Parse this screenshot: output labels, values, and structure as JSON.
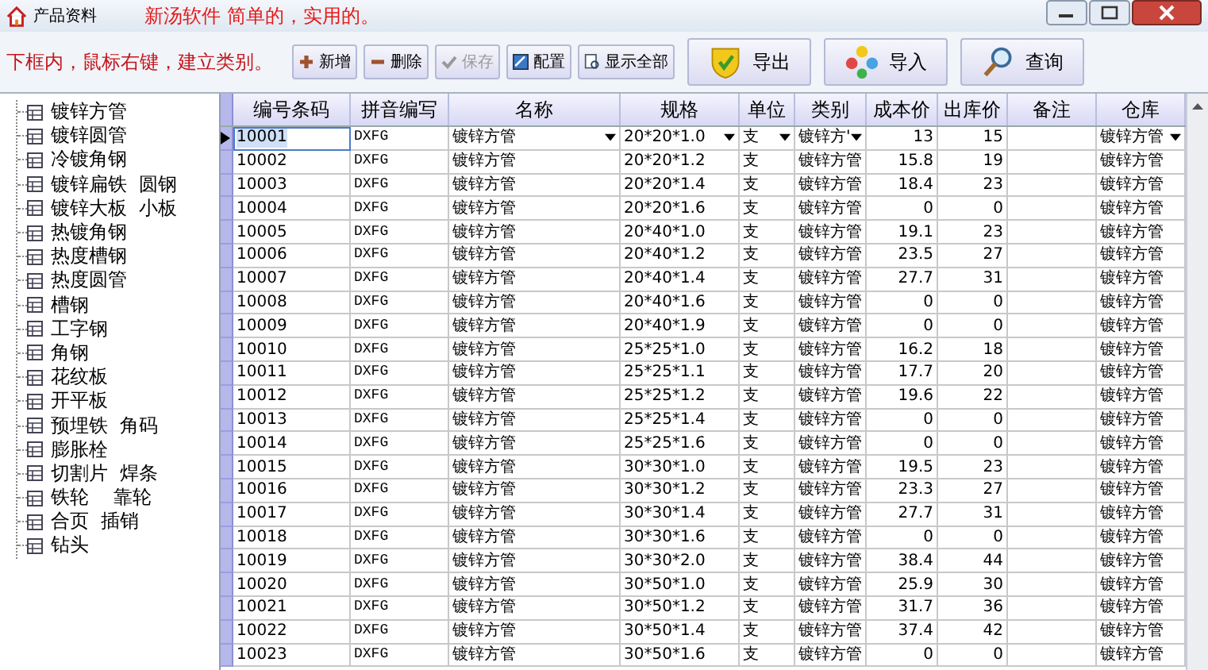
{
  "window": {
    "title": "产品资料",
    "slogan": "新汤软件 简单的，实用的。"
  },
  "toolbar": {
    "hint": "下框内，鼠标右键，建立类别。",
    "buttons": [
      {
        "label": "新增",
        "kind": "small",
        "disabled": false
      },
      {
        "label": "删除",
        "kind": "small",
        "disabled": false
      },
      {
        "label": "保存",
        "kind": "small",
        "disabled": true
      },
      {
        "label": "配置",
        "kind": "small",
        "disabled": false
      },
      {
        "label": "显示全部",
        "kind": "small",
        "disabled": false
      },
      {
        "label": "导出",
        "kind": "large",
        "disabled": false
      },
      {
        "label": "导入",
        "kind": "large",
        "disabled": false
      },
      {
        "label": "查询",
        "kind": "large",
        "disabled": false
      }
    ]
  },
  "sidebar": {
    "items": [
      "镀锌方管",
      "镀锌圆管",
      "冷镀角钢",
      "镀锌扁铁  圆钢",
      "镀锌大板  小板",
      "热镀角钢",
      "热度槽钢",
      "热度圆管",
      "槽钢",
      "工字钢",
      "角钢",
      "花纹板",
      "开平板",
      "预埋铁  角码",
      "膨胀栓",
      "切割片  焊条",
      "铁轮    靠轮",
      "合页  插销",
      "钻头"
    ]
  },
  "table": {
    "columns": [
      "编号条码",
      "拼音编写",
      "名称",
      "规格",
      "单位",
      "类别",
      "成本价",
      "出库价",
      "备注",
      "仓库"
    ],
    "rows": [
      {
        "selected": true,
        "code": "10001",
        "pinyin": "DXFG",
        "name": "镀锌方管",
        "spec": "20*20*1.0",
        "unit": "支",
        "category": "镀锌方'",
        "cost": "13",
        "price": "15",
        "warehouse": "镀锌方管"
      },
      {
        "selected": false,
        "code": "10002",
        "pinyin": "DXFG",
        "name": "镀锌方管",
        "spec": "20*20*1.2",
        "unit": "支",
        "category": "镀锌方管",
        "cost": "15.8",
        "price": "19",
        "warehouse": "镀锌方管"
      },
      {
        "selected": false,
        "code": "10003",
        "pinyin": "DXFG",
        "name": "镀锌方管",
        "spec": "20*20*1.4",
        "unit": "支",
        "category": "镀锌方管",
        "cost": "18.4",
        "price": "23",
        "warehouse": "镀锌方管"
      },
      {
        "selected": false,
        "code": "10004",
        "pinyin": "DXFG",
        "name": "镀锌方管",
        "spec": "20*20*1.6",
        "unit": "支",
        "category": "镀锌方管",
        "cost": "0",
        "price": "0",
        "warehouse": "镀锌方管"
      },
      {
        "selected": false,
        "code": "10005",
        "pinyin": "DXFG",
        "name": "镀锌方管",
        "spec": "20*40*1.0",
        "unit": "支",
        "category": "镀锌方管",
        "cost": "19.1",
        "price": "23",
        "warehouse": "镀锌方管"
      },
      {
        "selected": false,
        "code": "10006",
        "pinyin": "DXFG",
        "name": "镀锌方管",
        "spec": "20*40*1.2",
        "unit": "支",
        "category": "镀锌方管",
        "cost": "23.5",
        "price": "27",
        "warehouse": "镀锌方管"
      },
      {
        "selected": false,
        "code": "10007",
        "pinyin": "DXFG",
        "name": "镀锌方管",
        "spec": "20*40*1.4",
        "unit": "支",
        "category": "镀锌方管",
        "cost": "27.7",
        "price": "31",
        "warehouse": "镀锌方管"
      },
      {
        "selected": false,
        "code": "10008",
        "pinyin": "DXFG",
        "name": "镀锌方管",
        "spec": "20*40*1.6",
        "unit": "支",
        "category": "镀锌方管",
        "cost": "0",
        "price": "0",
        "warehouse": "镀锌方管"
      },
      {
        "selected": false,
        "code": "10009",
        "pinyin": "DXFG",
        "name": "镀锌方管",
        "spec": "20*40*1.9",
        "unit": "支",
        "category": "镀锌方管",
        "cost": "0",
        "price": "0",
        "warehouse": "镀锌方管"
      },
      {
        "selected": false,
        "code": "10010",
        "pinyin": "DXFG",
        "name": "镀锌方管",
        "spec": "25*25*1.0",
        "unit": "支",
        "category": "镀锌方管",
        "cost": "16.2",
        "price": "18",
        "warehouse": "镀锌方管"
      },
      {
        "selected": false,
        "code": "10011",
        "pinyin": "DXFG",
        "name": "镀锌方管",
        "spec": "25*25*1.1",
        "unit": "支",
        "category": "镀锌方管",
        "cost": "17.7",
        "price": "20",
        "warehouse": "镀锌方管"
      },
      {
        "selected": false,
        "code": "10012",
        "pinyin": "DXFG",
        "name": "镀锌方管",
        "spec": "25*25*1.2",
        "unit": "支",
        "category": "镀锌方管",
        "cost": "19.6",
        "price": "22",
        "warehouse": "镀锌方管"
      },
      {
        "selected": false,
        "code": "10013",
        "pinyin": "DXFG",
        "name": "镀锌方管",
        "spec": "25*25*1.4",
        "unit": "支",
        "category": "镀锌方管",
        "cost": "0",
        "price": "0",
        "warehouse": "镀锌方管"
      },
      {
        "selected": false,
        "code": "10014",
        "pinyin": "DXFG",
        "name": "镀锌方管",
        "spec": "25*25*1.6",
        "unit": "支",
        "category": "镀锌方管",
        "cost": "0",
        "price": "0",
        "warehouse": "镀锌方管"
      },
      {
        "selected": false,
        "code": "10015",
        "pinyin": "DXFG",
        "name": "镀锌方管",
        "spec": "30*30*1.0",
        "unit": "支",
        "category": "镀锌方管",
        "cost": "19.5",
        "price": "23",
        "warehouse": "镀锌方管"
      },
      {
        "selected": false,
        "code": "10016",
        "pinyin": "DXFG",
        "name": "镀锌方管",
        "spec": "30*30*1.2",
        "unit": "支",
        "category": "镀锌方管",
        "cost": "23.3",
        "price": "27",
        "warehouse": "镀锌方管"
      },
      {
        "selected": false,
        "code": "10017",
        "pinyin": "DXFG",
        "name": "镀锌方管",
        "spec": "30*30*1.4",
        "unit": "支",
        "category": "镀锌方管",
        "cost": "27.7",
        "price": "31",
        "warehouse": "镀锌方管"
      },
      {
        "selected": false,
        "code": "10018",
        "pinyin": "DXFG",
        "name": "镀锌方管",
        "spec": "30*30*1.6",
        "unit": "支",
        "category": "镀锌方管",
        "cost": "0",
        "price": "0",
        "warehouse": "镀锌方管"
      },
      {
        "selected": false,
        "code": "10019",
        "pinyin": "DXFG",
        "name": "镀锌方管",
        "spec": "30*30*2.0",
        "unit": "支",
        "category": "镀锌方管",
        "cost": "38.4",
        "price": "44",
        "warehouse": "镀锌方管"
      },
      {
        "selected": false,
        "code": "10020",
        "pinyin": "DXFG",
        "name": "镀锌方管",
        "spec": "30*50*1.0",
        "unit": "支",
        "category": "镀锌方管",
        "cost": "25.9",
        "price": "30",
        "warehouse": "镀锌方管"
      },
      {
        "selected": false,
        "code": "10021",
        "pinyin": "DXFG",
        "name": "镀锌方管",
        "spec": "30*50*1.2",
        "unit": "支",
        "category": "镀锌方管",
        "cost": "31.7",
        "price": "36",
        "warehouse": "镀锌方管"
      },
      {
        "selected": false,
        "code": "10022",
        "pinyin": "DXFG",
        "name": "镀锌方管",
        "spec": "30*50*1.4",
        "unit": "支",
        "category": "镀锌方管",
        "cost": "37.4",
        "price": "42",
        "warehouse": "镀锌方管"
      },
      {
        "selected": false,
        "code": "10023",
        "pinyin": "DXFG",
        "name": "镀锌方管",
        "spec": "30*50*1.6",
        "unit": "支",
        "category": "镀锌方管",
        "cost": "0",
        "price": "0",
        "warehouse": "镀锌方管"
      }
    ]
  }
}
